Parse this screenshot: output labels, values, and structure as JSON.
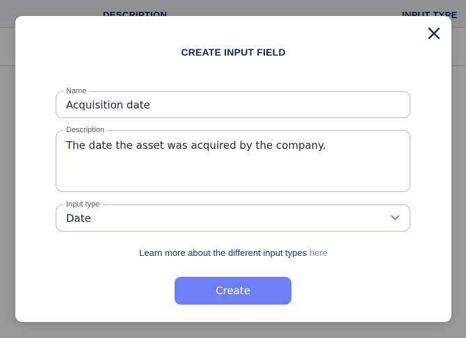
{
  "background": {
    "columns": [
      "DESCRIPTION",
      "INPUT TYPE"
    ]
  },
  "modal": {
    "title": "CREATE INPUT FIELD",
    "close_icon": "close-icon",
    "fields": {
      "name": {
        "label": "Name",
        "value": "Acquisition date"
      },
      "description": {
        "label": "Description",
        "value": "The date the asset was acquired by the company."
      },
      "input_type": {
        "label": "Input type",
        "value": "Date",
        "icon": "chevron-down-icon"
      }
    },
    "learn_more": {
      "text": "Learn more about the different input types",
      "link": "here"
    },
    "create_label": "Create"
  },
  "colors": {
    "title": "#0f2a66",
    "accent": "#6d7ff7",
    "link": "#6f7df5"
  }
}
